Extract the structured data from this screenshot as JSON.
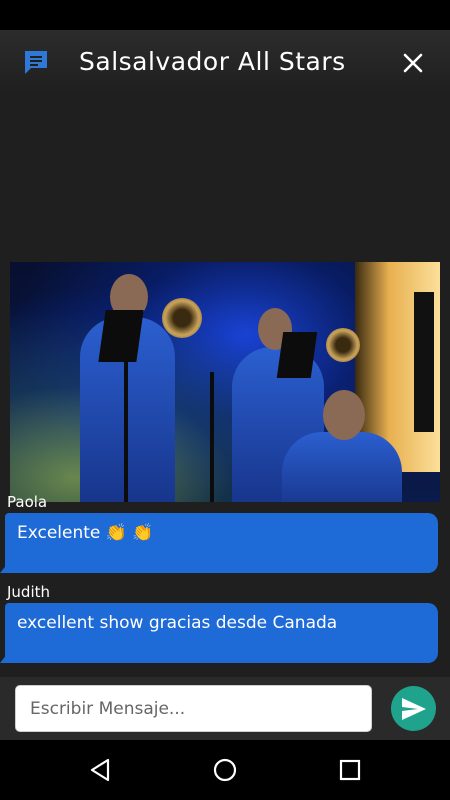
{
  "header": {
    "title": "Salsalvador All Stars",
    "chat_icon": "chat-bubble-icon",
    "close_icon": "close-icon"
  },
  "video": {
    "description_icon": "live-video-frame"
  },
  "messages": [
    {
      "sender": "Paola",
      "text": "Excelente 👏 👏"
    },
    {
      "sender": "Judith",
      "text": "excellent show gracias desde Canada"
    }
  ],
  "composer": {
    "placeholder": "Escribir Mensaje...",
    "send_icon": "send-icon"
  },
  "nav": {
    "back_icon": "back-triangle-icon",
    "home_icon": "home-circle-icon",
    "recents_icon": "recents-square-icon"
  },
  "colors": {
    "bubble": "#1e6ad6",
    "send_button": "#1fa38c",
    "chat_icon": "#2f78d8",
    "background": "#1f1f1f"
  }
}
